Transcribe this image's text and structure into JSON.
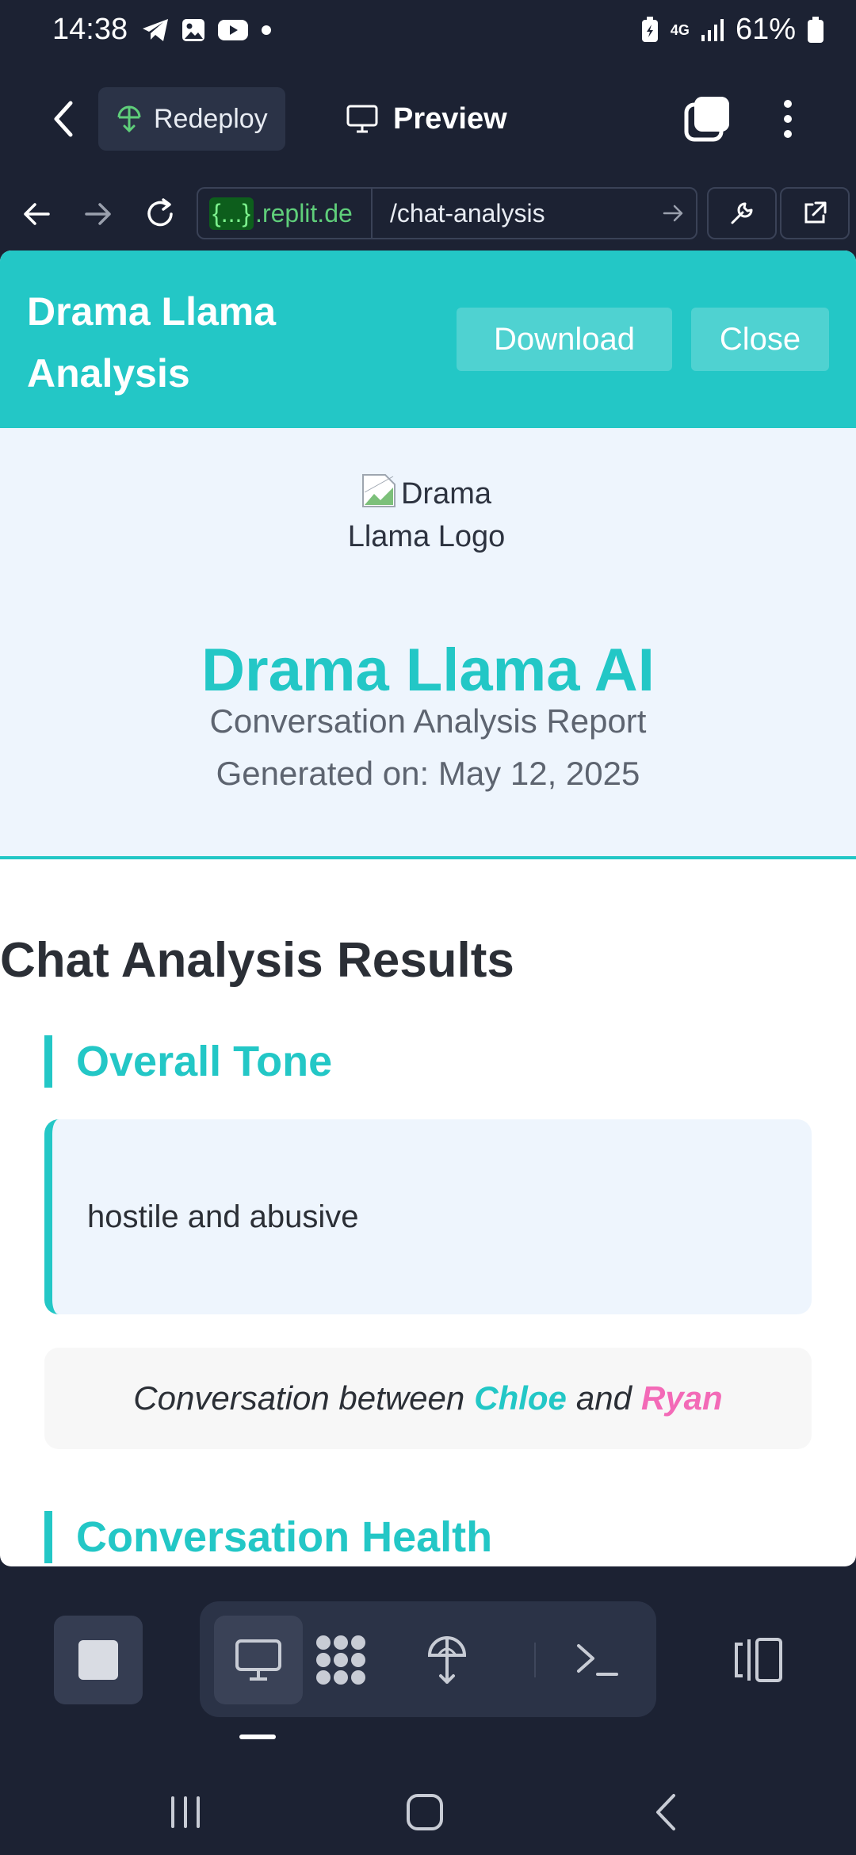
{
  "status_bar": {
    "time": "14:38",
    "network": "4G",
    "battery": "61%",
    "icons": [
      "telegram-icon",
      "gallery-icon",
      "youtube-icon",
      "dot-icon",
      "battery-saver-icon",
      "signal-icon",
      "battery-icon"
    ]
  },
  "replit_bar": {
    "redeploy_label": "Redeploy",
    "preview_label": "Preview"
  },
  "url_bar": {
    "host_prefix": "{...}",
    "host": ".replit.de",
    "path": "/chat-analysis"
  },
  "app": {
    "title": "Drama Llama Analysis",
    "download_label": "Download",
    "close_label": "Close",
    "logo_alt": "Drama Llama Logo",
    "hero_title": "Drama Llama AI",
    "hero_subtitle": "Conversation Analysis Report",
    "generated_on": "Generated on: May 12, 2025",
    "results_title": "Chat Analysis Results",
    "overall_tone_heading": "Overall Tone",
    "overall_tone_value": "hostile and abusive",
    "conversation_prefix": "Conversation between",
    "participant_1": "Chloe",
    "conversation_joiner": "and",
    "participant_2": "Ryan",
    "health_heading": "Conversation Health",
    "accent_color": "#23c7c6",
    "participant_2_color": "#f36ab7"
  },
  "bottom_toolbar": {
    "tools": [
      "preview-tool",
      "grid-tool",
      "deploy-tool",
      "shell-tool"
    ]
  }
}
